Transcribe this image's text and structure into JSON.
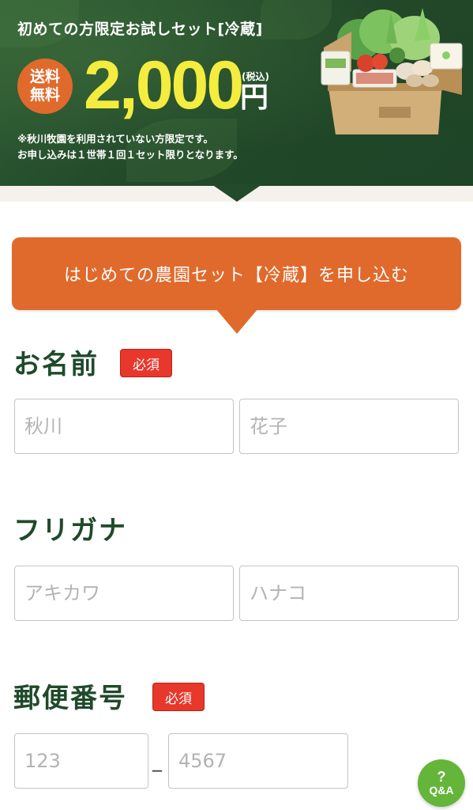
{
  "hero": {
    "title": "初めての方限定お試しセット[冷蔵]",
    "badge_line1": "送料",
    "badge_line2": "無料",
    "price": "2,000",
    "tax_note": "(税込)",
    "currency": "円",
    "note1": "※秋川牧園を利用されていない方限定です。",
    "note2": "お申し込みは１世帯１回１セット限りとなります。"
  },
  "apply_button": {
    "label": "はじめての農園セット【冷蔵】を申し込む"
  },
  "form": {
    "name": {
      "label": "お名前",
      "required_label": "必須",
      "last_placeholder": "秋川",
      "first_placeholder": "花子"
    },
    "furigana": {
      "label": "フリガナ",
      "last_placeholder": "アキカワ",
      "first_placeholder": "ハナコ"
    },
    "postal": {
      "label": "郵便番号",
      "required_label": "必須",
      "part1_placeholder": "123",
      "separator": "_",
      "part2_placeholder": "4567"
    }
  },
  "qa_button": {
    "icon_text": "?",
    "label": "Q&A"
  },
  "colors": {
    "hero_green": "#234a2a",
    "accent_orange": "#e06a2c",
    "price_yellow": "#f4ec3f",
    "required_red": "#e8372b",
    "label_green": "#1f4a2a",
    "qa_green": "#64b53a"
  }
}
